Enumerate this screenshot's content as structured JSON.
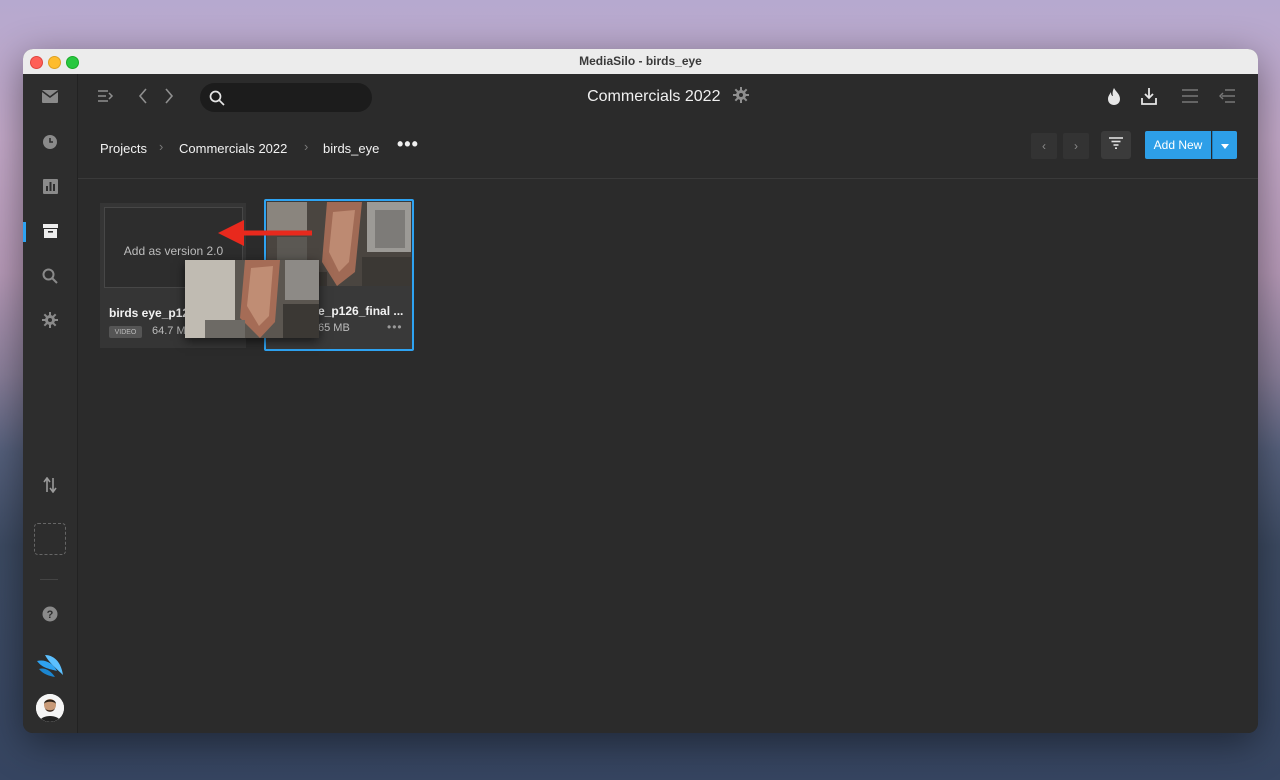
{
  "window": {
    "title": "MediaSilo - birds_eye"
  },
  "sidebar": {
    "items": [
      {
        "icon": "inbox-icon"
      },
      {
        "icon": "clock-icon"
      },
      {
        "icon": "analytics-icon"
      },
      {
        "icon": "archive-icon",
        "active": true
      },
      {
        "icon": "search-icon"
      },
      {
        "icon": "gear-icon"
      }
    ],
    "bottom": [
      {
        "icon": "sort-arrows-icon"
      },
      {
        "icon": "help-icon"
      },
      {
        "icon": "mediasilo-logo-icon"
      }
    ],
    "accent": "#2ea3f2"
  },
  "topbar": {
    "search_placeholder": "",
    "title": "Commercials 2022"
  },
  "breadcrumb": {
    "items": [
      "Projects",
      "Commercials 2022",
      "birds_eye"
    ],
    "more": "•••"
  },
  "toolbar": {
    "add_new_label": "Add New",
    "prev_label": "‹",
    "next_label": "›"
  },
  "cards": [
    {
      "title": "birds eye_p12",
      "badge": "VIDEO",
      "size": "64.7 MB",
      "drop_text": "Add as version 2.0"
    },
    {
      "title": "e_p126_final ...",
      "size": "65 MB",
      "more": "•••",
      "selected": true
    }
  ],
  "colors": {
    "accent": "#2d9fe8",
    "drag_arrow": "#e8291d",
    "background": "#2b2b2b"
  }
}
